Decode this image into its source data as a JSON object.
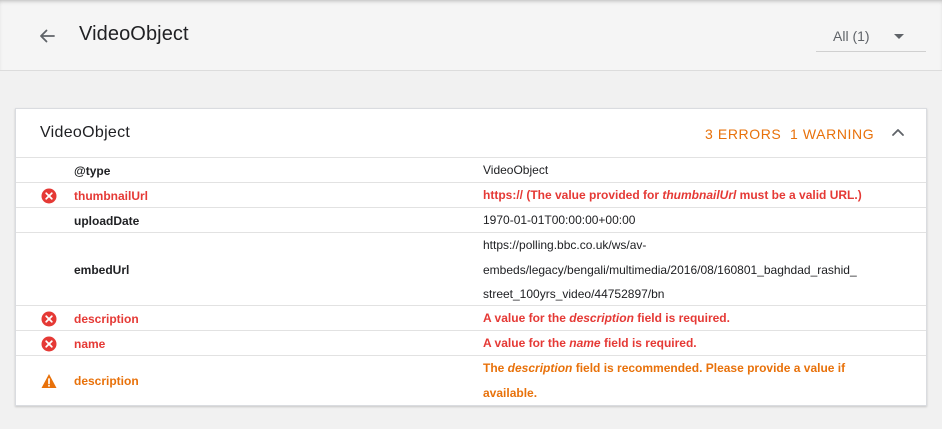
{
  "header": {
    "title": "VideoObject",
    "filter_label": "All (1)"
  },
  "card": {
    "title": "VideoObject",
    "errors_label": "3 ERRORS",
    "warnings_label": "1 WARNING"
  },
  "colors": {
    "error": "#e53935",
    "warning": "#e8710a",
    "text": "#202124"
  },
  "rows": [
    {
      "status": "ok",
      "key": "@type",
      "value": [
        "VideoObject"
      ]
    },
    {
      "status": "error",
      "icon": "error-circle-icon",
      "key": "thumbnailUrl",
      "value_parts": [
        "https:// (The value provided for ",
        "thumbnailUrl",
        " must be a valid URL.)"
      ]
    },
    {
      "status": "ok",
      "key": "uploadDate",
      "value": [
        "1970-01-01T00:00:00+00:00"
      ]
    },
    {
      "status": "ok",
      "key": "embedUrl",
      "value": [
        "https://polling.bbc.co.uk/ws/av-",
        "embeds/legacy/bengali/multimedia/2016/08/160801_baghdad_rashid_",
        "street_100yrs_video/44752897/bn"
      ]
    },
    {
      "status": "error",
      "icon": "error-circle-icon",
      "key": "description",
      "value_parts": [
        "A value for the ",
        "description",
        " field is required."
      ]
    },
    {
      "status": "error",
      "icon": "error-circle-icon",
      "key": "name",
      "value_parts": [
        "A value for the ",
        "name",
        " field is required."
      ]
    },
    {
      "status": "warning",
      "icon": "warning-triangle-icon",
      "key": "description",
      "value_parts": [
        "The ",
        "description",
        " field is recommended. Please provide a value if"
      ],
      "value_line2": "available."
    }
  ]
}
